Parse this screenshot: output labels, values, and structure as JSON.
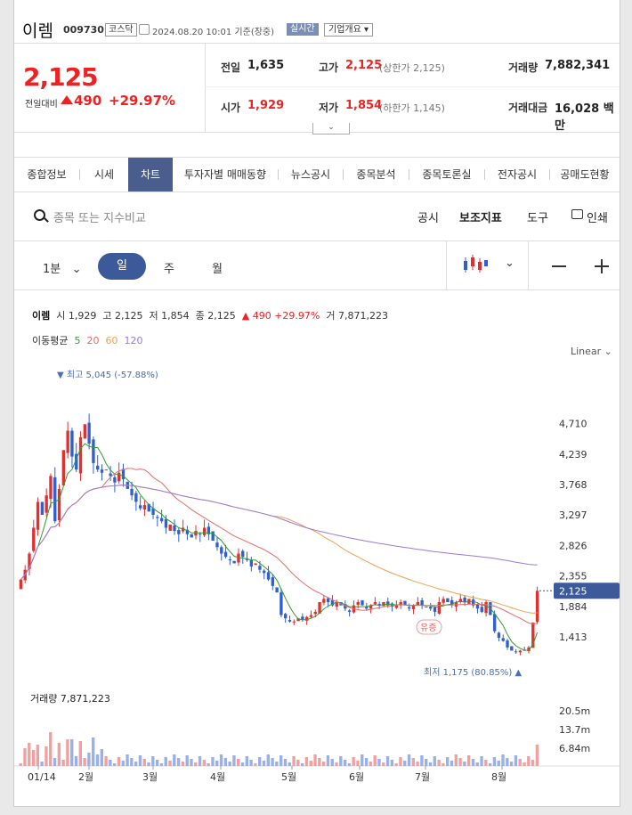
{
  "header": {
    "name": "이렘",
    "code": "009730",
    "market": "코스닥",
    "datetime": "2024.08.20 10:01 기준(장중)",
    "realtime": "실시간",
    "company_info": "기업개요"
  },
  "price": {
    "current": "2,125",
    "vs_label": "전일대비",
    "change": "490",
    "change_pct": "+29.97%",
    "prev_label": "전일",
    "prev": "1,635",
    "high_label": "고가",
    "high": "2,125",
    "upper_limit": "(상한가 2,125)",
    "volume_label": "거래량",
    "volume": "7,882,341",
    "open_label": "시가",
    "open": "1,929",
    "low_label": "저가",
    "low": "1,854",
    "lower_limit": "(하한가 1,145)",
    "amount_label": "거래대금",
    "amount": "16,028 백만"
  },
  "tabs": [
    "종합정보",
    "시세",
    "차트",
    "투자자별 매매동향",
    "뉴스공시",
    "종목분석",
    "종목토론실",
    "전자공시",
    "공매도현황"
  ],
  "toolbar": {
    "search_placeholder": "종목 또는 지수비교",
    "disclosure": "공시",
    "indicator": "보조지표",
    "tools": "도구",
    "print": "인쇄"
  },
  "periods": {
    "minute": "1분",
    "day": "일",
    "week": "주",
    "month": "월"
  },
  "info_line": {
    "name": "이렘",
    "open_label": "시",
    "open": "1,929",
    "high_label": "고",
    "high": "2,125",
    "low_label": "저",
    "low": "1,854",
    "close_label": "종",
    "close": "2,125",
    "change": "▲ 490",
    "pct": "+29.97%",
    "vol_label": "거",
    "vol": "7,871,223"
  },
  "ma_legend": {
    "label": "이동평균",
    "ma5": "5",
    "ma20": "20",
    "ma60": "60",
    "ma120": "120"
  },
  "scale": "Linear",
  "chart_data": {
    "type": "candlestick",
    "y_ticks": [
      "4,710",
      "4,239",
      "3,768",
      "3,297",
      "2,826",
      "2,355",
      "1,884",
      "1,413"
    ],
    "x_ticks": [
      "01/14",
      "2월",
      "3월",
      "4월",
      "5월",
      "6월",
      "7월",
      "8월"
    ],
    "ylim": [
      1000,
      5200
    ],
    "current_price_tag": "2,125",
    "max_label": "▼ 최고 5,045 (-57.88%)",
    "min_label": "최저 1,175 (80.85%) ▲",
    "event_label": "유증",
    "closes": [
      2300,
      2450,
      2700,
      3100,
      3500,
      3300,
      3600,
      3900,
      3200,
      3700,
      4300,
      4600,
      4200,
      4000,
      4500,
      4700,
      4400,
      4100,
      4000,
      3950,
      4000,
      3900,
      3800,
      3950,
      3850,
      3700,
      3600,
      3500,
      3400,
      3450,
      3350,
      3300,
      3250,
      3200,
      3100,
      3150,
      3050,
      3000,
      3100,
      3000,
      2950,
      3050,
      3000,
      3100,
      3000,
      2900,
      2800,
      2700,
      2650,
      2600,
      2550,
      2700,
      2650,
      2600,
      2500,
      2550,
      2450,
      2400,
      2300,
      2200,
      2100,
      1750,
      1700,
      1650,
      1650,
      1700,
      1680,
      1720,
      1750,
      1800,
      1950,
      2000,
      1950,
      1900,
      1950,
      1900,
      1850,
      1800,
      1900,
      1950,
      1900,
      1850,
      1900,
      1950,
      1900,
      1950,
      1900,
      1880,
      1900,
      1950,
      1900,
      1850,
      1900,
      1950,
      1900,
      1880,
      1850,
      1800,
      1950,
      2000,
      1950,
      1900,
      1950,
      2000,
      1950,
      2000,
      1900,
      1850,
      1800,
      1950,
      1750,
      1500,
      1400,
      1350,
      1250,
      1200,
      1175,
      1200,
      1210,
      1250,
      1635,
      2125
    ],
    "volume_ticks": [
      "20.5m",
      "13.7m",
      "6.84m"
    ],
    "volume_label": "거래량",
    "volume": "7,871,223"
  },
  "colors": {
    "up": "#e03030",
    "down": "#3060d0",
    "ma5": "#2e9e2e",
    "ma20": "#e86a6a",
    "ma60": "#f0a050",
    "ma120": "#9a7ad8",
    "accent": "#4a5e8e"
  }
}
